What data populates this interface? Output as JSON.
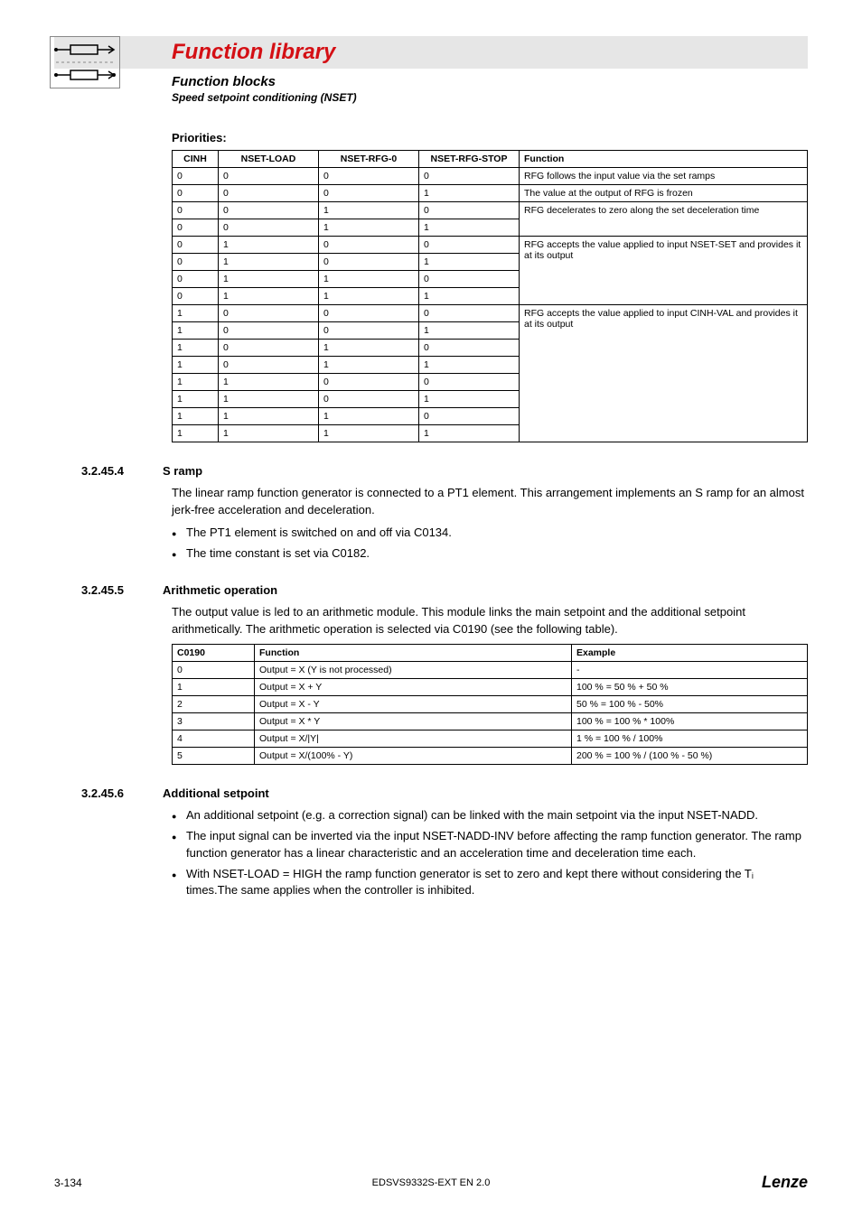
{
  "header": {
    "title": "Function library",
    "subtitle1": "Function blocks",
    "subtitle2": "Speed setpoint conditioning (NSET)"
  },
  "priorities": {
    "label": "Priorities:",
    "headers": [
      "CINH",
      "NSET-LOAD",
      "NSET-RFG-0",
      "NSET-RFG-STOP",
      "Function"
    ],
    "rows": [
      {
        "c": [
          "0",
          "0",
          "0",
          "0"
        ],
        "fn": "RFG follows the input value via the set ramps",
        "span": 1
      },
      {
        "c": [
          "0",
          "0",
          "0",
          "1"
        ],
        "fn": "The value at the output of RFG is frozen",
        "span": 1
      },
      {
        "c": [
          "0",
          "0",
          "1",
          "0"
        ],
        "fn": "RFG decelerates to zero along the set deceleration time",
        "span": 2
      },
      {
        "c": [
          "0",
          "0",
          "1",
          "1"
        ]
      },
      {
        "c": [
          "0",
          "1",
          "0",
          "0"
        ],
        "fn": "RFG accepts the value applied to input NSET-SET and provides it at its output",
        "span": 4
      },
      {
        "c": [
          "0",
          "1",
          "0",
          "1"
        ]
      },
      {
        "c": [
          "0",
          "1",
          "1",
          "0"
        ]
      },
      {
        "c": [
          "0",
          "1",
          "1",
          "1"
        ]
      },
      {
        "c": [
          "1",
          "0",
          "0",
          "0"
        ],
        "fn": "RFG accepts the value applied to input CINH-VAL and provides it at its output",
        "span": 8
      },
      {
        "c": [
          "1",
          "0",
          "0",
          "1"
        ]
      },
      {
        "c": [
          "1",
          "0",
          "1",
          "0"
        ]
      },
      {
        "c": [
          "1",
          "0",
          "1",
          "1"
        ]
      },
      {
        "c": [
          "1",
          "1",
          "0",
          "0"
        ]
      },
      {
        "c": [
          "1",
          "1",
          "0",
          "1"
        ]
      },
      {
        "c": [
          "1",
          "1",
          "1",
          "0"
        ]
      },
      {
        "c": [
          "1",
          "1",
          "1",
          "1"
        ]
      }
    ]
  },
  "s_ramp": {
    "num": "3.2.45.4",
    "title": "S ramp",
    "para": "The linear ramp function generator is connected to a PT1 element. This arrangement implements an S ramp for an almost jerk-free acceleration and deceleration.",
    "bullets": [
      "The PT1 element is switched on and off via C0134.",
      "The time constant is set via C0182."
    ]
  },
  "arith": {
    "num": "3.2.45.5",
    "title": "Arithmetic operation",
    "para": "The output value is led to an arithmetic module. This module links the main setpoint and the additional setpoint arithmetically. The arithmetic operation is selected via C0190 (see the following table).",
    "headers": [
      "C0190",
      "Function",
      "Example"
    ],
    "rows": [
      [
        "0",
        "Output = X (Y is not processed)",
        "-"
      ],
      [
        "1",
        "Output = X + Y",
        "100 % = 50 % + 50 %"
      ],
      [
        "2",
        "Output = X - Y",
        "50 % = 100 % - 50%"
      ],
      [
        "3",
        "Output = X * Y",
        "100 % = 100 % * 100%"
      ],
      [
        "4",
        "Output =  X/|Y|",
        "1 % = 100 % / 100%"
      ],
      [
        "5",
        "Output = X/(100%  - Y)",
        "200 % = 100 % / (100 % - 50 %)"
      ]
    ]
  },
  "addsp": {
    "num": "3.2.45.6",
    "title": "Additional setpoint",
    "bullets": [
      "An additional setpoint (e.g. a correction signal) can be linked with the main setpoint via the input NSET-NADD.",
      "The input signal can be inverted via the input NSET-NADD-INV before affecting the ramp function generator. The ramp function generator has a linear characteristic and an acceleration time and deceleration time each.",
      "With NSET-LOAD = HIGH the ramp function generator is set to zero and kept there without considering the Tᵢ times.The same applies when the controller is inhibited."
    ]
  },
  "footer": {
    "left": "3-134",
    "center": "EDSVS9332S-EXT EN 2.0",
    "right": "Lenze"
  }
}
